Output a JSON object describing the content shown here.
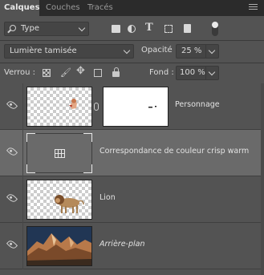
{
  "tabs": [
    {
      "label": "Calques",
      "active": true
    },
    {
      "label": "Couches",
      "active": false
    },
    {
      "label": "Tracés",
      "active": false
    }
  ],
  "filter": {
    "kind_label": "Type",
    "icons": [
      "image-filter-icon",
      "adjustment-filter-icon",
      "type-filter-icon",
      "shape-filter-icon",
      "smart-object-filter-icon",
      "filter-toggle"
    ]
  },
  "blend": {
    "mode": "Lumière tamisée",
    "opacity_label": "Opacité :",
    "opacity_value": "25 %"
  },
  "lock": {
    "label": "Verrou :",
    "fill_label": "Fond :",
    "fill_value": "100 %"
  },
  "layers": [
    {
      "name": "Personnage",
      "type": "masked",
      "selected": false
    },
    {
      "name": "Correspondance de couleur crisp warm",
      "type": "adjustment",
      "selected": true
    },
    {
      "name": "Lion",
      "type": "pixel",
      "selected": false
    },
    {
      "name": "Arrière-plan",
      "type": "background",
      "selected": false
    }
  ]
}
